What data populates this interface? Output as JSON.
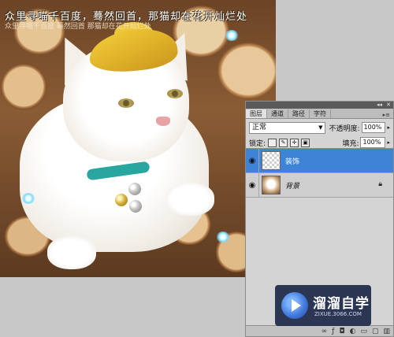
{
  "canvas": {
    "overlay_line1": "众里寻喵千百度，蓦然回首，那猫却在花开灿烂处",
    "overlay_line2": "众里寻喵千百度 蓦然回首 那猫却在花开灿烂处"
  },
  "layers_panel": {
    "tabs": [
      {
        "label": "图层",
        "active": true
      },
      {
        "label": "通道",
        "active": false
      },
      {
        "label": "路径",
        "active": false
      },
      {
        "label": "字符",
        "active": false
      }
    ],
    "blend_mode": "正常",
    "opacity_label": "不透明度:",
    "opacity_value": "100%",
    "lock_label": "锁定:",
    "fill_label": "填充:",
    "fill_value": "100%",
    "layers": [
      {
        "name": "装饰",
        "selected": true,
        "thumbnail": "transparent"
      },
      {
        "name": "背景",
        "selected": false,
        "thumbnail": "photo",
        "locked": true
      }
    ]
  },
  "watermark": {
    "title": "溜溜自学",
    "url": "ZIXUE.3066.COM"
  },
  "colors": {
    "selection": "#3e83d6",
    "panel_bg": "#d4d4d4",
    "workspace": "#c8c8c8"
  },
  "icons": [
    "eye-icon",
    "lock-icon",
    "brush-icon",
    "move-icon",
    "link-icon",
    "fx-icon",
    "mask-icon",
    "folder-icon",
    "new-layer-icon",
    "trash-icon"
  ]
}
